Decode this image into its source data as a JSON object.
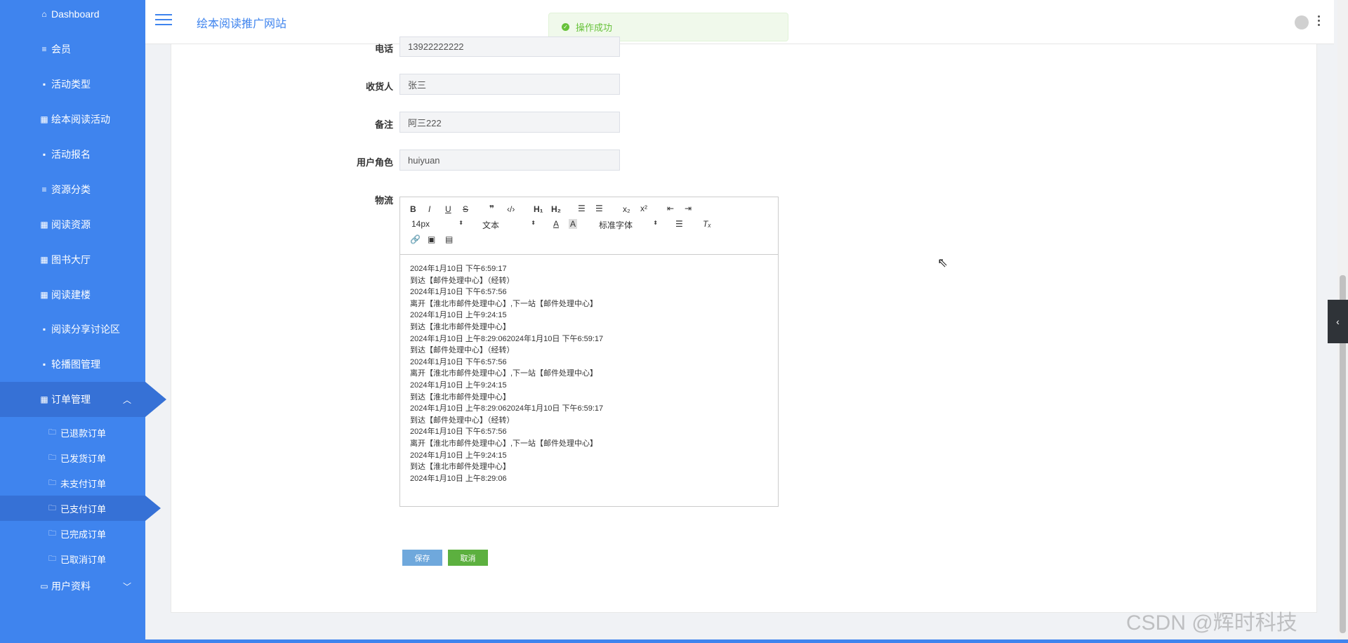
{
  "sidebar": {
    "items": [
      {
        "label": "Dashboard",
        "icon": "⌂"
      },
      {
        "label": "会员",
        "icon": "≡"
      },
      {
        "label": "活动类型",
        "icon": "▪"
      },
      {
        "label": "绘本阅读活动",
        "icon": "▦"
      },
      {
        "label": "活动报名",
        "icon": "▪"
      },
      {
        "label": "资源分类",
        "icon": "≡"
      },
      {
        "label": "阅读资源",
        "icon": "▦"
      },
      {
        "label": "图书大厅",
        "icon": "▦"
      },
      {
        "label": "阅读建楼",
        "icon": "▦"
      },
      {
        "label": "阅读分享讨论区",
        "icon": "▪"
      },
      {
        "label": "轮播图管理",
        "icon": "▪"
      },
      {
        "label": "订单管理",
        "icon": "▦"
      }
    ],
    "order_sub_items": [
      "已退款订单",
      "已发货订单",
      "未支付订单",
      "已支付订单",
      "已完成订单",
      "已取消订单"
    ],
    "user_info": "用户资料"
  },
  "header": {
    "title": "绘本阅读推广网站",
    "toast": "操作成功"
  },
  "form": {
    "phone": {
      "label": "电话",
      "value": "13922222222"
    },
    "receiver": {
      "label": "收货人",
      "value": "张三"
    },
    "remark": {
      "label": "备注",
      "value": "阿三222"
    },
    "role": {
      "label": "用户角色",
      "value": "huiyuan"
    },
    "logistics": {
      "label": "物流"
    }
  },
  "editor": {
    "font_size": "14px",
    "text_type": "文本",
    "font_family": "标准字体",
    "lines": [
      "2024年1月10日 下午6:59:17",
      "到达【邮件处理中心】（经转）",
      "2024年1月10日 下午6:57:56",
      "离开【淮北市邮件处理中心】,下一站【邮件处理中心】",
      "2024年1月10日 上午9:24:15",
      "到达【淮北市邮件处理中心】",
      "2024年1月10日 上午8:29:062024年1月10日 下午6:59:17",
      "到达【邮件处理中心】（经转）",
      "2024年1月10日 下午6:57:56",
      "离开【淮北市邮件处理中心】,下一站【邮件处理中心】",
      "2024年1月10日 上午9:24:15",
      "到达【淮北市邮件处理中心】",
      "2024年1月10日 上午8:29:062024年1月10日 下午6:59:17",
      "到达【邮件处理中心】（经转）",
      "2024年1月10日 下午6:57:56",
      "离开【淮北市邮件处理中心】,下一站【邮件处理中心】",
      "2024年1月10日 上午9:24:15",
      "到达【淮北市邮件处理中心】",
      "2024年1月10日 上午8:29:06"
    ]
  },
  "buttons": {
    "save": "保存",
    "cancel": "取消"
  },
  "watermark": "CSDN @辉时科技",
  "colors": {
    "sidebar": "#3f84ee",
    "active": "#3671d6",
    "success": "#67c23a"
  }
}
